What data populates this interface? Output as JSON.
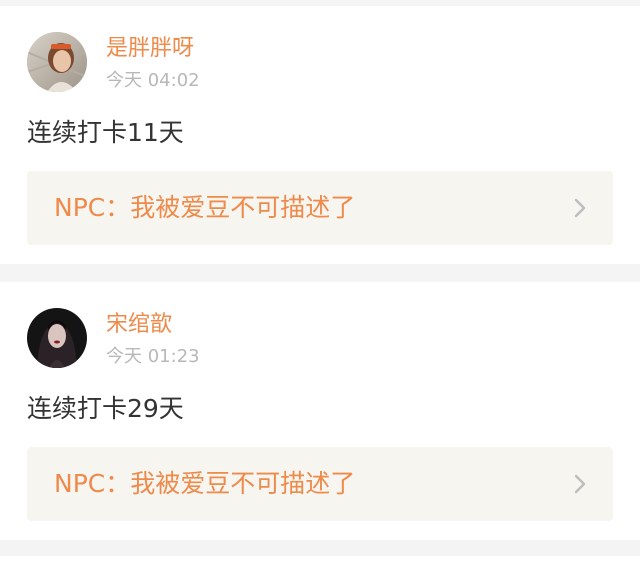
{
  "posts": [
    {
      "username": "是胖胖呀",
      "timestamp": "今天 04:02",
      "content": "连续打卡11天",
      "link_text": "NPC：我被爱豆不可描述了"
    },
    {
      "username": "宋绾歆",
      "timestamp": "今天 01:23",
      "content": "连续打卡29天",
      "link_text": "NPC：我被爱豆不可描述了"
    }
  ],
  "colors": {
    "accent": "#ee8a4a",
    "muted": "#b8b8b8",
    "text": "#333333",
    "card_bg": "#f6f5f0",
    "page_bg": "#f5f4f4"
  },
  "icons": {
    "link_card_arrow": "chevron-right-icon"
  }
}
